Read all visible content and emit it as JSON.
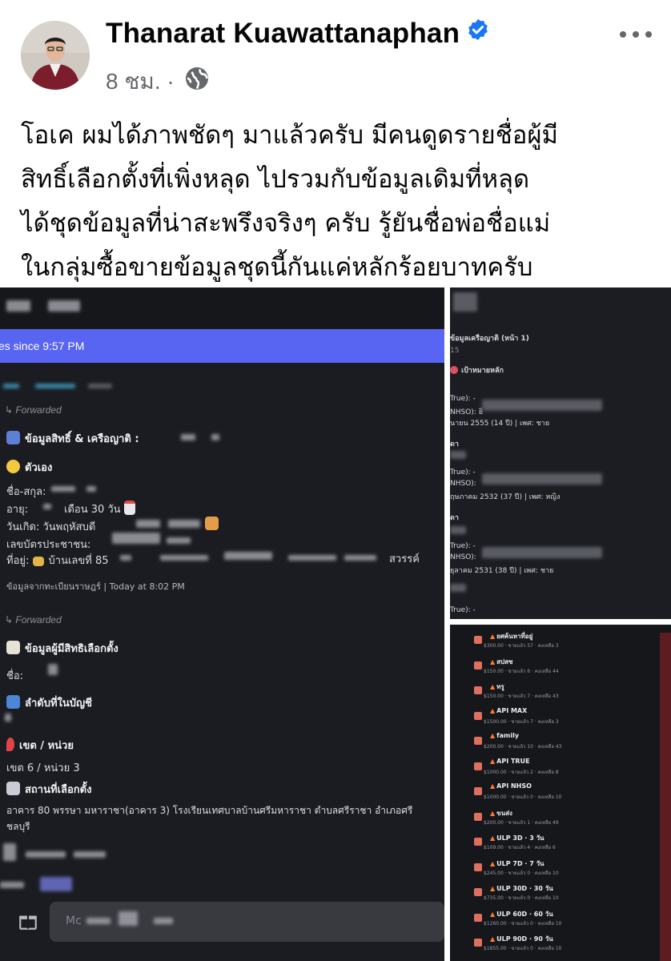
{
  "post": {
    "author": "Thanarat Kuawattanaphan",
    "time": "8 ชม. ·",
    "text_lines": [
      "โอเค ผมได้ภาพชัดๆ มาแล้วครับ มีคนดูดรายชื่อผู้มี",
      "สิทธิ์เลือกตั้งที่เพิ่งหลุด ไปรวมกับข้อมูลเดิมที่หลุด",
      "ได้ชุดข้อมูลที่น่าสะพรึงจริงๆ ครับ รู้ยันชื่อพ่อชื่อแม่",
      "ในกลุ่มซื้อขายข้อมูลชุดนี้กันแค่หลักร้อยบาทครับ"
    ],
    "icons": {
      "verified": "verified-badge-icon",
      "audience": "globe-icon",
      "menu": "more-options-icon"
    },
    "colors": {
      "verified": "#1877f2",
      "text": "#050505",
      "meta": "#65676b"
    }
  },
  "chat": {
    "banner": "es since 9:57 PM",
    "forwarded_1": "Forwarded",
    "section_1_title": "ข้อมูลสิทธิ์ & เครือญาติ :",
    "self_label": "ตัวเอง",
    "field_name": "ชื่อ-สกุล:",
    "field_age": "อายุ:",
    "field_age_value": "เดือน 30 วัน",
    "field_birth": "วันเกิด: วันพฤหัสบดี",
    "field_id": "เลขบัตรประชาชน:",
    "field_addr": "ที่อยู่:",
    "field_addr_value": "บ้านเลขที่ 85",
    "field_addr_end": "สวรรค์",
    "footer_1": "ข้อมูลจากทะเบียนราษฎร์ | Today at 8:02 PM",
    "forwarded_2": "Forwarded",
    "section_2_title": "ข้อมูลผู้มีสิทธิเลือกตั้ง",
    "name_label": "ชื่อ:",
    "order_label": "ลำดับที่ในบัญชี",
    "zone_label": "เขต / หน่วย",
    "zone_value": "เขต 6 / หน่วย 3",
    "place_label": "สถานที่เลือกตั้ง",
    "place_value": "อาคาร 80 พรรษา มหาราชา(อาคาร 3) โรงเรียนเทศบาลบ้านศรีมหาราชา ตำบลศรีราชา อำเภอศรี",
    "place_value_2": "ชลบุรี",
    "input_placeholder": "Mc",
    "accent": "#5865f2"
  },
  "relatives": {
    "header": "ข้อมูลเครือญาติ (หน้า 1)",
    "sub": "15",
    "target": "เป้าหมายหลัก",
    "lines": [
      "True): -",
      "NHSO): ยิ",
      "นายน 2555 (14 ปี) | เพศ: ชาย",
      "ดา",
      "True): -",
      "NHSO):",
      "ฤษภาคม 2532 (37 ปี) | เพศ: หญิง",
      "ดา",
      "True): -",
      "NHSO):",
      "ยุลาคม 2531 (38 ปี) | เพศ: ชาย",
      "True): -"
    ]
  },
  "shop": {
    "items": [
      {
        "name": "ยศค้นหาที่อยู่",
        "sub": "$300.00 · ขายแล้ว 57 · คงเหลือ 3"
      },
      {
        "name": "สปสช",
        "sub": "$150.00 · ขายแล้ว 6 · คงเหลือ 44"
      },
      {
        "name": "ทรู",
        "sub": "$150.00 · ขายแล้ว 7 · คงเหลือ 43"
      },
      {
        "name": "API MAX",
        "sub": "$1500.00 · ขายแล้ว 7 · คงเหลือ 3"
      },
      {
        "name": "family",
        "sub": "$200.00 · ขายแล้ว 10 · คงเหลือ 43"
      },
      {
        "name": "API TRUE",
        "sub": "$1000.00 · ขายแล้ว 2 · คงเหลือ 8"
      },
      {
        "name": "API NHSO",
        "sub": "$1000.00 · ขายแล้ว 0 · คงเหลือ 10"
      },
      {
        "name": "ขนส่ง",
        "sub": "$200.00 · ขายแล้ว 1 · คงเหลือ 49"
      },
      {
        "name": "ULP 3D · 3 วัน",
        "sub": "$109.00 · ขายแล้ว 4 · คงเหลือ 6"
      },
      {
        "name": "ULP 7D · 7 วัน",
        "sub": "$245.00 · ขายแล้ว 0 · คงเหลือ 10"
      },
      {
        "name": "ULP 30D · 30 วัน",
        "sub": "$735.00 · ขายแล้ว 0 · คงเหลือ 10"
      },
      {
        "name": "ULP 60D · 60 วัน",
        "sub": "$1260.00 · ขายแล้ว 0 · คงเหลือ 10"
      },
      {
        "name": "ULP 90D · 90 วัน",
        "sub": "$1855.00 · ขายแล้ว 0 · คงเหลือ 10"
      }
    ]
  }
}
